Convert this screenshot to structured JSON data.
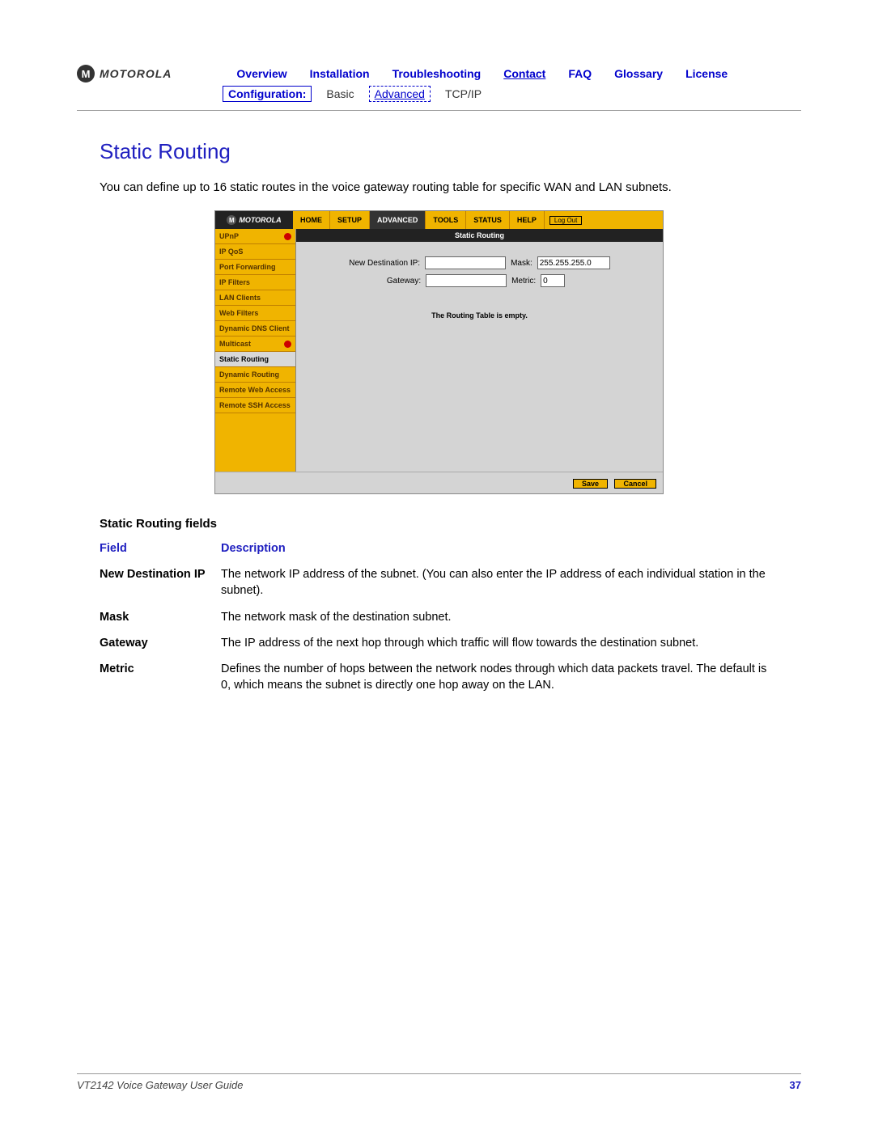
{
  "brand": "MOTOROLA",
  "nav": {
    "items": [
      "Overview",
      "Installation",
      "Troubleshooting",
      "Contact",
      "FAQ",
      "Glossary",
      "License"
    ],
    "sub": {
      "label": "Configuration:",
      "basic": "Basic",
      "advanced": "Advanced",
      "tcpip": "TCP/IP"
    }
  },
  "heading": "Static Routing",
  "intro": "You can define up to 16 static routes in the voice gateway routing table for specific WAN and LAN subnets.",
  "shot": {
    "tabs": [
      "HOME",
      "SETUP",
      "ADVANCED",
      "TOOLS",
      "STATUS",
      "HELP"
    ],
    "active_tab": "ADVANCED",
    "logout": "Log Out",
    "sidebar": [
      {
        "label": "UPnP",
        "dot": true
      },
      {
        "label": "IP QoS"
      },
      {
        "label": "Port Forwarding"
      },
      {
        "label": "IP Filters"
      },
      {
        "label": "LAN Clients"
      },
      {
        "label": "Web Filters"
      },
      {
        "label": "Dynamic DNS Client"
      },
      {
        "label": "Multicast",
        "dot": true
      },
      {
        "label": "Static Routing",
        "active": true
      },
      {
        "label": "Dynamic Routing"
      },
      {
        "label": "Remote Web Access"
      },
      {
        "label": "Remote SSH Access"
      }
    ],
    "band": "Static Routing",
    "form": {
      "dest_label": "New Destination IP:",
      "dest_value": "",
      "mask_label": "Mask:",
      "mask_value": "255.255.255.0",
      "gw_label": "Gateway:",
      "gw_value": "",
      "metric_label": "Metric:",
      "metric_value": "0"
    },
    "empty": "The Routing Table is empty.",
    "save": "Save",
    "cancel": "Cancel"
  },
  "subhead": "Static Routing fields",
  "table": {
    "col1": "Field",
    "col2": "Description",
    "rows": [
      {
        "f": "New Destination IP",
        "d": "The network IP address of the subnet. (You can also enter the IP address of each individual station in the subnet)."
      },
      {
        "f": "Mask",
        "d": "The network mask of the destination subnet."
      },
      {
        "f": "Gateway",
        "d": "The IP address of the next hop through which traffic will flow towards the destination subnet."
      },
      {
        "f": "Metric",
        "d": "Defines the number of hops between the network nodes through which data packets travel. The default is 0, which means the subnet is directly one hop away on the LAN."
      }
    ]
  },
  "footer": {
    "left": "VT2142 Voice Gateway User Guide",
    "right": "37"
  }
}
